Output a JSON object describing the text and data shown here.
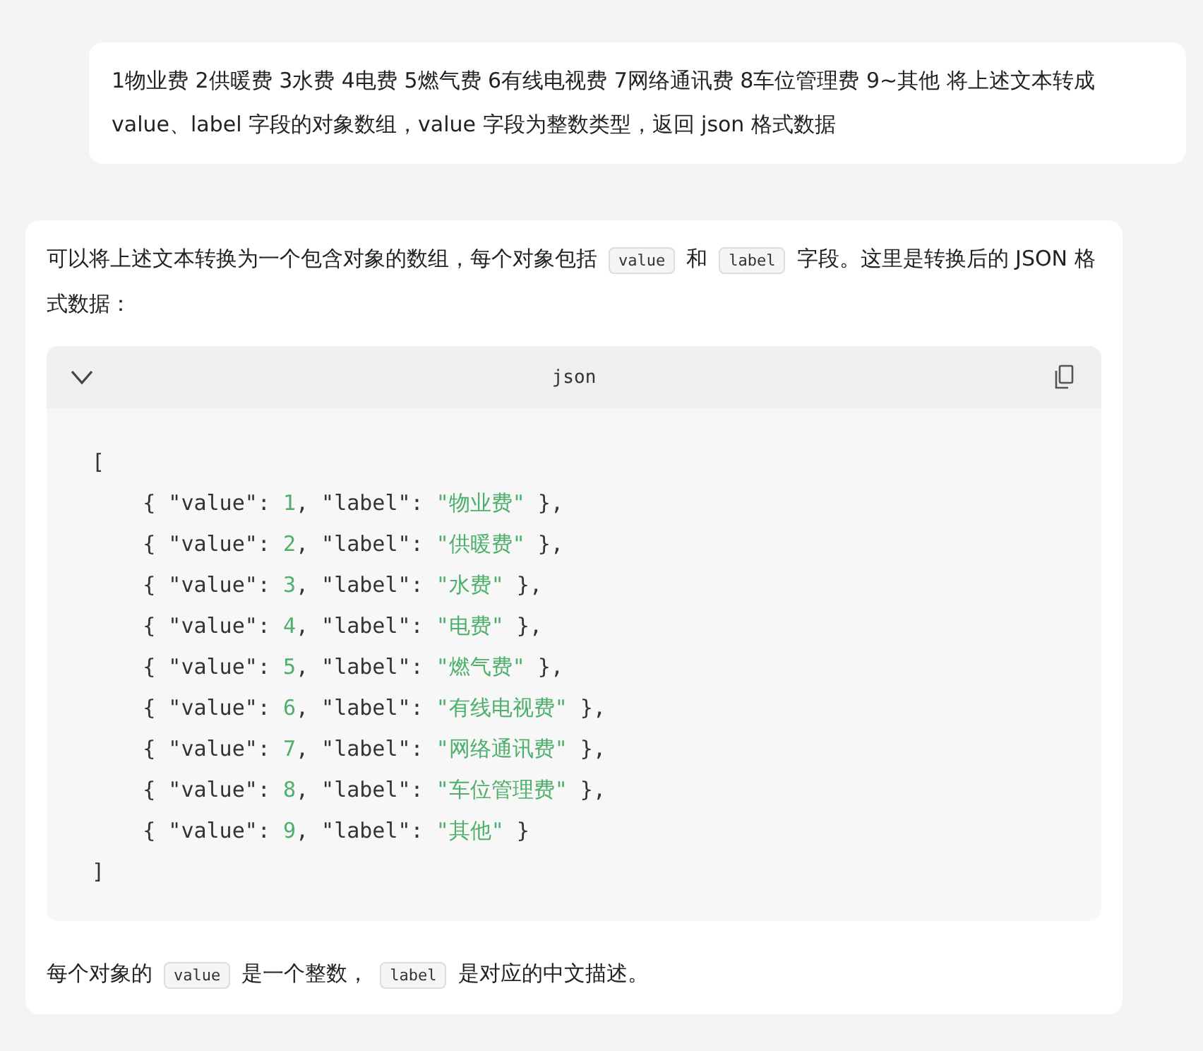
{
  "user_message": {
    "text": "1物业费 2供暖费 3水费 4电费 5燃气费 6有线电视费 7网络通讯费 8车位管理费 9~其他 将上述文本转成 value、label 字段的对象数组，value 字段为整数类型，返回 json 格式数据"
  },
  "reply": {
    "intro": [
      {
        "kind": "text",
        "text": "可以将上述文本转换为一个包含对象的数组，每个对象包括"
      },
      {
        "kind": "code",
        "text": "value"
      },
      {
        "kind": "text",
        "text": "和"
      },
      {
        "kind": "code",
        "text": "label"
      },
      {
        "kind": "text",
        "text": "字段。这里是转换后的 JSON 格式数据："
      }
    ],
    "code_block": {
      "language": "json",
      "expanded": true,
      "lines": [
        [
          {
            "kind": "plain",
            "text": "["
          }
        ],
        [
          {
            "kind": "plain",
            "text": "    { \"value\": "
          },
          {
            "kind": "literal",
            "text": "1"
          },
          {
            "kind": "plain",
            "text": ", \"label\": "
          },
          {
            "kind": "literal",
            "text": "\"物业费\""
          },
          {
            "kind": "plain",
            "text": " },"
          }
        ],
        [
          {
            "kind": "plain",
            "text": "    { \"value\": "
          },
          {
            "kind": "literal",
            "text": "2"
          },
          {
            "kind": "plain",
            "text": ", \"label\": "
          },
          {
            "kind": "literal",
            "text": "\"供暖费\""
          },
          {
            "kind": "plain",
            "text": " },"
          }
        ],
        [
          {
            "kind": "plain",
            "text": "    { \"value\": "
          },
          {
            "kind": "literal",
            "text": "3"
          },
          {
            "kind": "plain",
            "text": ", \"label\": "
          },
          {
            "kind": "literal",
            "text": "\"水费\""
          },
          {
            "kind": "plain",
            "text": " },"
          }
        ],
        [
          {
            "kind": "plain",
            "text": "    { \"value\": "
          },
          {
            "kind": "literal",
            "text": "4"
          },
          {
            "kind": "plain",
            "text": ", \"label\": "
          },
          {
            "kind": "literal",
            "text": "\"电费\""
          },
          {
            "kind": "plain",
            "text": " },"
          }
        ],
        [
          {
            "kind": "plain",
            "text": "    { \"value\": "
          },
          {
            "kind": "literal",
            "text": "5"
          },
          {
            "kind": "plain",
            "text": ", \"label\": "
          },
          {
            "kind": "literal",
            "text": "\"燃气费\""
          },
          {
            "kind": "plain",
            "text": " },"
          }
        ],
        [
          {
            "kind": "plain",
            "text": "    { \"value\": "
          },
          {
            "kind": "literal",
            "text": "6"
          },
          {
            "kind": "plain",
            "text": ", \"label\": "
          },
          {
            "kind": "literal",
            "text": "\"有线电视费\""
          },
          {
            "kind": "plain",
            "text": " },"
          }
        ],
        [
          {
            "kind": "plain",
            "text": "    { \"value\": "
          },
          {
            "kind": "literal",
            "text": "7"
          },
          {
            "kind": "plain",
            "text": ", \"label\": "
          },
          {
            "kind": "literal",
            "text": "\"网络通讯费\""
          },
          {
            "kind": "plain",
            "text": " },"
          }
        ],
        [
          {
            "kind": "plain",
            "text": "    { \"value\": "
          },
          {
            "kind": "literal",
            "text": "8"
          },
          {
            "kind": "plain",
            "text": ", \"label\": "
          },
          {
            "kind": "literal",
            "text": "\"车位管理费\""
          },
          {
            "kind": "plain",
            "text": " },"
          }
        ],
        [
          {
            "kind": "plain",
            "text": "    { \"value\": "
          },
          {
            "kind": "literal",
            "text": "9"
          },
          {
            "kind": "plain",
            "text": ", \"label\": "
          },
          {
            "kind": "literal",
            "text": "\"其他\""
          },
          {
            "kind": "plain",
            "text": " }"
          }
        ],
        [
          {
            "kind": "plain",
            "text": "]"
          }
        ]
      ]
    },
    "outro": [
      {
        "kind": "text",
        "text": "每个对象的"
      },
      {
        "kind": "code",
        "text": "value"
      },
      {
        "kind": "text",
        "text": "是一个整数，"
      },
      {
        "kind": "code",
        "text": "label"
      },
      {
        "kind": "text",
        "text": "是对应的中文描述。"
      }
    ]
  }
}
